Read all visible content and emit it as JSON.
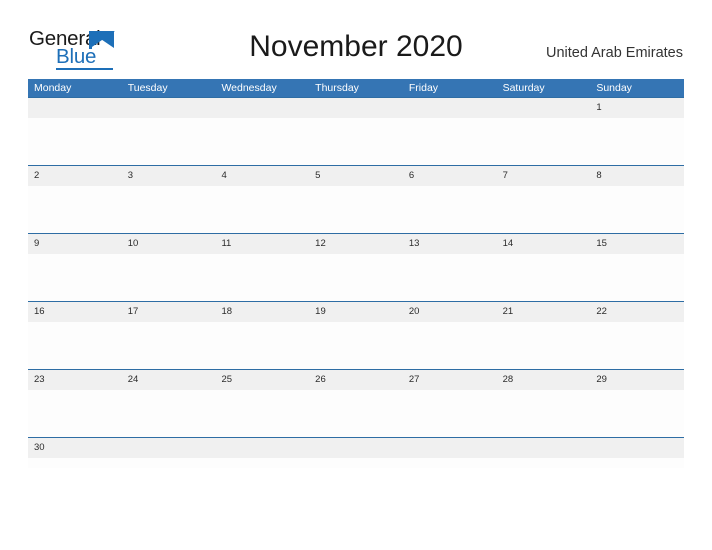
{
  "brand": {
    "name_part1": "General",
    "name_part2": "Blue",
    "flag_icon": "triangle-flag-icon",
    "color_dark": "#1a1a1a",
    "color_blue": "#1d6fb8"
  },
  "header": {
    "title": "November 2020",
    "country": "United Arab Emirates"
  },
  "theme": {
    "header_bar": "#3575b4",
    "row_divider": "#2e6da4",
    "date_band": "#f0f0f0",
    "page_background": "#ffffff"
  },
  "calendar": {
    "month": "November",
    "year": "2020",
    "weekdays": [
      "Monday",
      "Tuesday",
      "Wednesday",
      "Thursday",
      "Friday",
      "Saturday",
      "Sunday"
    ],
    "weeks": [
      {
        "days": [
          "",
          "",
          "",
          "",
          "",
          "",
          "1"
        ]
      },
      {
        "days": [
          "2",
          "3",
          "4",
          "5",
          "6",
          "7",
          "8"
        ]
      },
      {
        "days": [
          "9",
          "10",
          "11",
          "12",
          "13",
          "14",
          "15"
        ]
      },
      {
        "days": [
          "16",
          "17",
          "18",
          "19",
          "20",
          "21",
          "22"
        ]
      },
      {
        "days": [
          "23",
          "24",
          "25",
          "26",
          "27",
          "28",
          "29"
        ]
      },
      {
        "days": [
          "30",
          "",
          "",
          "",
          "",
          "",
          ""
        ]
      }
    ]
  }
}
